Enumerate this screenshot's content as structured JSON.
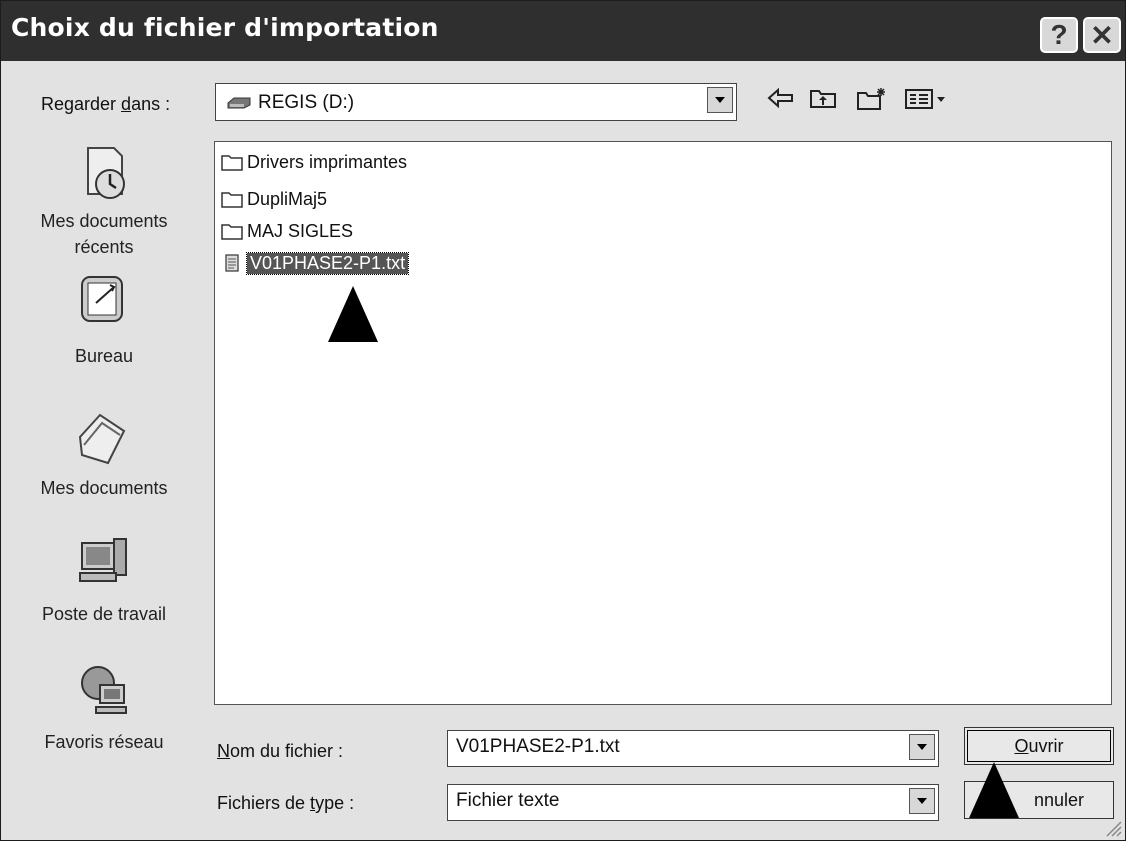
{
  "window": {
    "title": "Choix du fichier d'importation",
    "help_label": "?",
    "close_label": "✕"
  },
  "lookin": {
    "label_pre": "Regarder ",
    "label_u": "d",
    "label_post": "ans :",
    "value": "REGIS (D:)"
  },
  "toolbar": [
    "back-icon",
    "up-folder-icon",
    "new-folder-icon",
    "view-menu-icon"
  ],
  "places": [
    {
      "label": "Mes documents récents",
      "icon": "recent-documents-icon"
    },
    {
      "label": "Bureau",
      "icon": "desktop-icon"
    },
    {
      "label": "Mes documents",
      "icon": "my-documents-icon"
    },
    {
      "label": "Poste de travail",
      "icon": "my-computer-icon"
    },
    {
      "label": "Favoris réseau",
      "icon": "network-places-icon"
    }
  ],
  "files": [
    {
      "name": "Drivers imprimantes",
      "type": "folder"
    },
    {
      "name": "DupliMaj5",
      "type": "folder"
    },
    {
      "name": "MAJ SIGLES",
      "type": "folder"
    },
    {
      "name": "V01PHASE2-P1.txt",
      "type": "text-file",
      "selected": true
    }
  ],
  "filename": {
    "label_u": "N",
    "label_post": "om du fichier :",
    "value": "V01PHASE2-P1.txt"
  },
  "filetype": {
    "label_pre": "Fichiers de ",
    "label_u": "t",
    "label_post": "ype :",
    "value": "Fichier texte"
  },
  "buttons": {
    "open_u": "O",
    "open_post": "uvrir",
    "cancel_visible": "nnuler"
  }
}
